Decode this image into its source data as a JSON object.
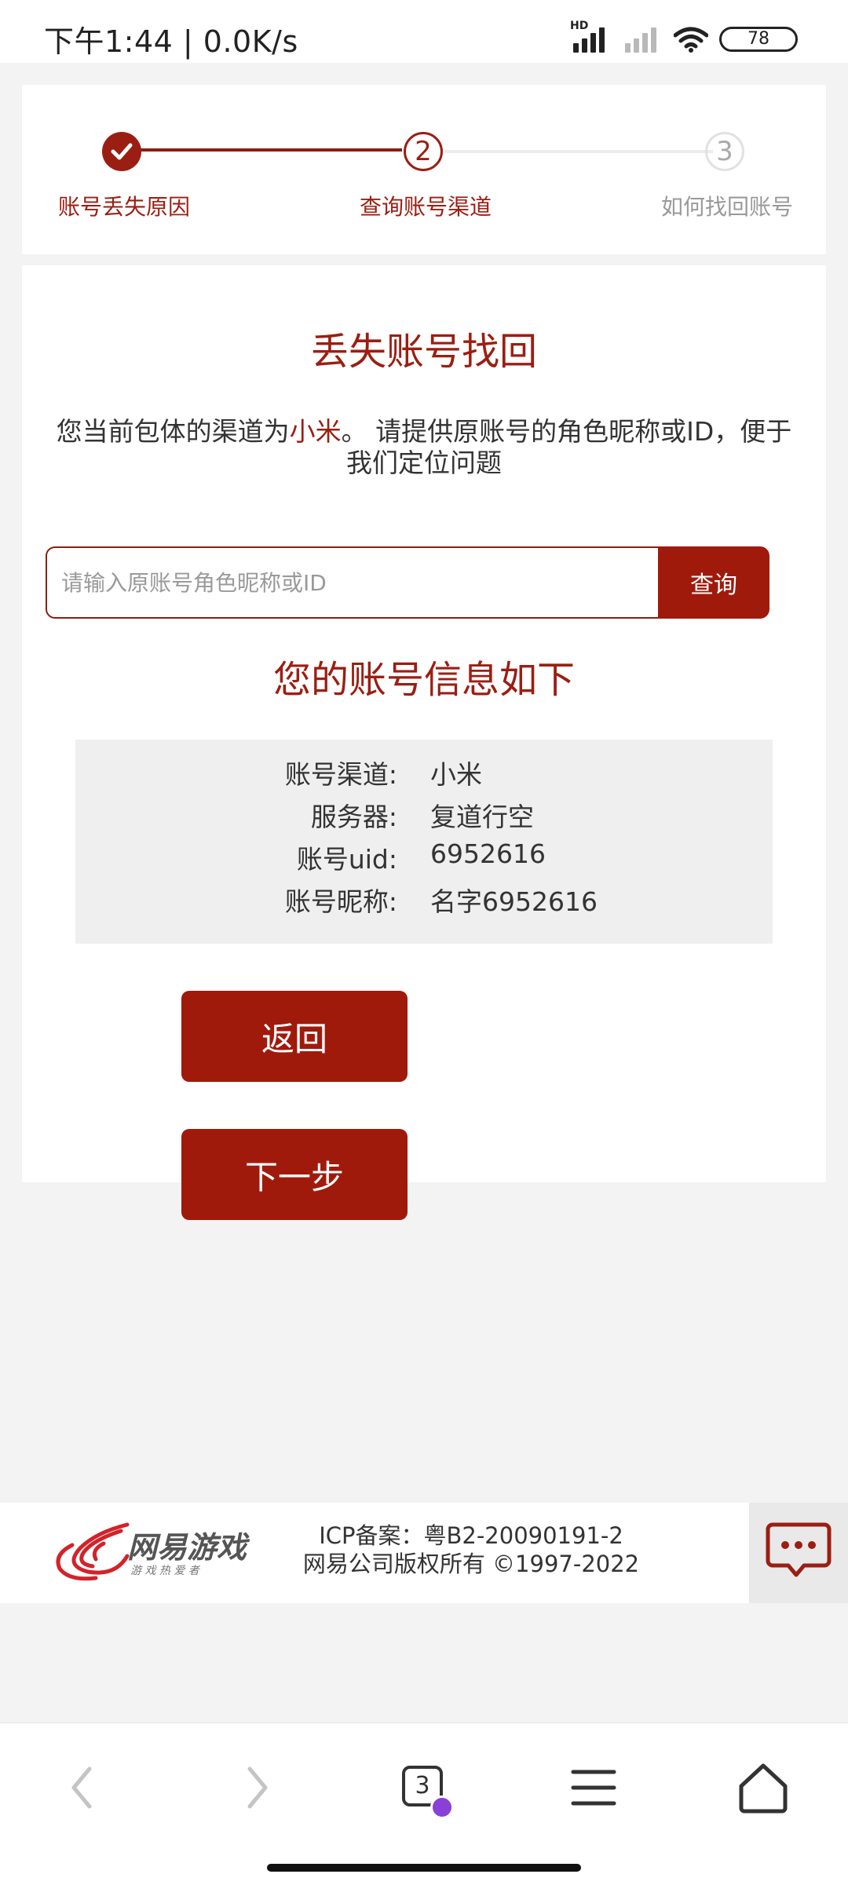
{
  "status_bar": {
    "time": "下午1:44 | 0.0K/s",
    "hd_label": "HD",
    "battery": "78"
  },
  "steps": [
    {
      "number": "1",
      "label": "账号丢失原因",
      "state": "done"
    },
    {
      "number": "2",
      "label": "查询账号渠道",
      "state": "current"
    },
    {
      "number": "3",
      "label": "如何找回账号",
      "state": "pending"
    }
  ],
  "main": {
    "title": "丢失账号找回",
    "desc_prefix": "您当前包体的渠道为",
    "desc_channel": "小米",
    "desc_suffix": "。 请提供原账号的角色昵称或ID，便于我们定位问题",
    "search": {
      "placeholder": "请输入原账号角色昵称或ID",
      "value": "",
      "button_label": "查询"
    },
    "info_title": "您的账号信息如下",
    "info": [
      {
        "key": "账号渠道:",
        "value": "小米"
      },
      {
        "key": "服务器:",
        "value": "复道行空"
      },
      {
        "key": "账号uid:",
        "value": "6952616"
      },
      {
        "key": "账号昵称:",
        "value": "名字6952616"
      }
    ],
    "back_label": "返回",
    "next_label": "下一步"
  },
  "footer": {
    "logo_text": "网易游戏",
    "logo_tagline": "游 戏 热 爱 者",
    "icp": "ICP备案：粤B2-20090191-2",
    "copyright": "网易公司版权所有 ©1997-2022"
  },
  "toolbar": {
    "tab_count": "3"
  },
  "colors": {
    "accent": "#a01a0c",
    "title_red": "#9b1e12",
    "page_bg": "#f3f3f3"
  }
}
